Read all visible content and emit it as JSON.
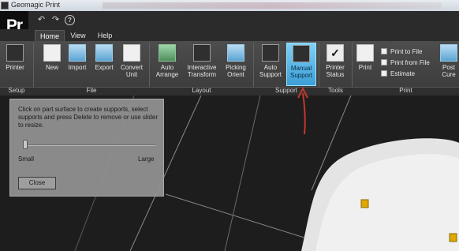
{
  "window": {
    "title": "Geomagic Print"
  },
  "logo": {
    "text": "Pr"
  },
  "quick_access": {
    "undo_icon": "undo-icon",
    "redo_icon": "redo-icon",
    "help_icon": "help-icon",
    "help_text": "?"
  },
  "tabs": [
    {
      "label": "Home",
      "active": true
    },
    {
      "label": "View",
      "active": false
    },
    {
      "label": "Help",
      "active": false
    }
  ],
  "ribbon": {
    "buttons": {
      "printer": "Printer",
      "new": "New",
      "import": "Import",
      "export": "Export",
      "convert_unit": "Convert\nUnit",
      "auto_arrange": "Auto\nArrange",
      "interactive_transform": "Interactive\nTransform",
      "picking_orient": "Picking\nOrient",
      "auto_support": "Auto\nSupport",
      "manual_support": "Manual\nSupport",
      "printer_status": "Printer\nStatus",
      "print": "Print",
      "post_cure": "Post\nCure"
    },
    "print_menu": {
      "print_to_file": "Print to File",
      "print_from_file": "Print from File",
      "estimate": "Estimate"
    },
    "groups": {
      "setup": "Setup",
      "file": "File",
      "layout": "Layout",
      "support": "Support",
      "tools": "Tools",
      "print": "Print"
    }
  },
  "panel": {
    "instructions": "Click on part surface to create supports, select supports and press Delete to remove or use slider to resize.",
    "small_label": "Small",
    "large_label": "Large",
    "close_label": "Close",
    "slider_value": 0.0
  },
  "colors": {
    "active_button": "#3d9ed6",
    "annotation_arrow": "#c0392b",
    "support_marker": "#e0a800"
  }
}
